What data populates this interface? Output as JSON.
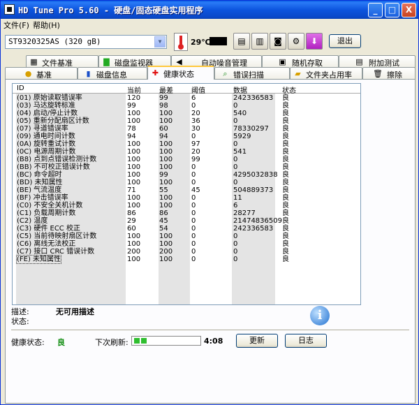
{
  "window": {
    "title": "HD Tune Pro 5.60 - 硬盘/固态硬盘实用程序",
    "minimize": "_",
    "maximize": "□",
    "close": "X"
  },
  "menu": {
    "file": "文件(F)",
    "help": "帮助(H)"
  },
  "toolbar": {
    "drive": "ST9320325AS (320 gB)",
    "temperature": "29℃",
    "exit_label": "退出"
  },
  "tabs_row1": [
    {
      "label": "文件基准",
      "icon": "file-benchmark-icon"
    },
    {
      "label": "磁盘监视器",
      "icon": "disk-monitor-icon"
    },
    {
      "label": "自动噪音管理",
      "icon": "speaker-icon"
    },
    {
      "label": "随机存取",
      "icon": "random-access-icon"
    },
    {
      "label": "附加测试",
      "icon": "extra-tests-icon"
    }
  ],
  "tabs_row2": [
    {
      "label": "基准",
      "icon": "benchmark-icon"
    },
    {
      "label": "磁盘信息",
      "icon": "disk-info-icon"
    },
    {
      "label": "健康状态",
      "icon": "health-icon",
      "active": true
    },
    {
      "label": "错误扫描",
      "icon": "error-scan-icon"
    },
    {
      "label": "文件夹占用率",
      "icon": "folder-usage-icon"
    },
    {
      "label": "擦除",
      "icon": "erase-icon"
    }
  ],
  "smart": {
    "headers": [
      "ID",
      "当前",
      "最差",
      "阈值",
      "数据",
      "状态"
    ],
    "rows": [
      [
        "(01) 原始读取错误率",
        "120",
        "99",
        "6",
        "242336583",
        "良"
      ],
      [
        "(03) 马达旋转标准",
        "99",
        "98",
        "0",
        "0",
        "良"
      ],
      [
        "(04) 启动/停止计数",
        "100",
        "100",
        "20",
        "540",
        "良"
      ],
      [
        "(05) 重新分配扇区计数",
        "100",
        "100",
        "36",
        "0",
        "良"
      ],
      [
        "(07) 寻道错误率",
        "78",
        "60",
        "30",
        "78330297",
        "良"
      ],
      [
        "(09) 通电时间计数",
        "94",
        "94",
        "0",
        "5929",
        "良"
      ],
      [
        "(0A) 旋转重试计数",
        "100",
        "100",
        "97",
        "0",
        "良"
      ],
      [
        "(0C) 电源周期计数",
        "100",
        "100",
        "20",
        "541",
        "良"
      ],
      [
        "(B8) 点到点错误检测计数",
        "100",
        "100",
        "99",
        "0",
        "良"
      ],
      [
        "(BB) 不可校正错误计数",
        "100",
        "100",
        "0",
        "0",
        "良"
      ],
      [
        "(BC) 命令超时",
        "100",
        "99",
        "0",
        "4295032838",
        "良"
      ],
      [
        "(BD) 未知属性",
        "100",
        "100",
        "0",
        "0",
        "良"
      ],
      [
        "(BE) 气流温度",
        "71",
        "55",
        "45",
        "504889373",
        "良"
      ],
      [
        "(BF) 冲击错误率",
        "100",
        "100",
        "0",
        "11",
        "良"
      ],
      [
        "(C0) 不安全关机计数",
        "100",
        "100",
        "0",
        "6",
        "良"
      ],
      [
        "(C1) 负载周期计数",
        "86",
        "86",
        "0",
        "28277",
        "良"
      ],
      [
        "(C2) 温度",
        "29",
        "45",
        "0",
        "21474836509",
        "良"
      ],
      [
        "(C3) 硬件 ECC 校正",
        "60",
        "54",
        "0",
        "242336583",
        "良"
      ],
      [
        "(C5) 当前待映射扇区计数",
        "100",
        "100",
        "0",
        "0",
        "良"
      ],
      [
        "(C6) 离线无法校正",
        "100",
        "100",
        "0",
        "0",
        "良"
      ],
      [
        "(C7) 接口 CRC 错误计数",
        "200",
        "200",
        "0",
        "0",
        "良"
      ],
      [
        "(FE) 未知属性",
        "100",
        "100",
        "0",
        "0",
        "良"
      ]
    ]
  },
  "details": {
    "desc_label": "描述:",
    "desc_value": "无可用描述",
    "status_label": "状态:"
  },
  "footer": {
    "health_label": "健康状态:",
    "health_value": "良",
    "refresh_label": "下次刷新:",
    "refresh_time": "4:08",
    "refresh_progress": 0.2,
    "update_label": "更新",
    "log_label": "日志"
  },
  "colors": {
    "health_green": "#0a8a0a",
    "progress_green": "#2fbe2f",
    "title_blue": "#0a55de"
  }
}
